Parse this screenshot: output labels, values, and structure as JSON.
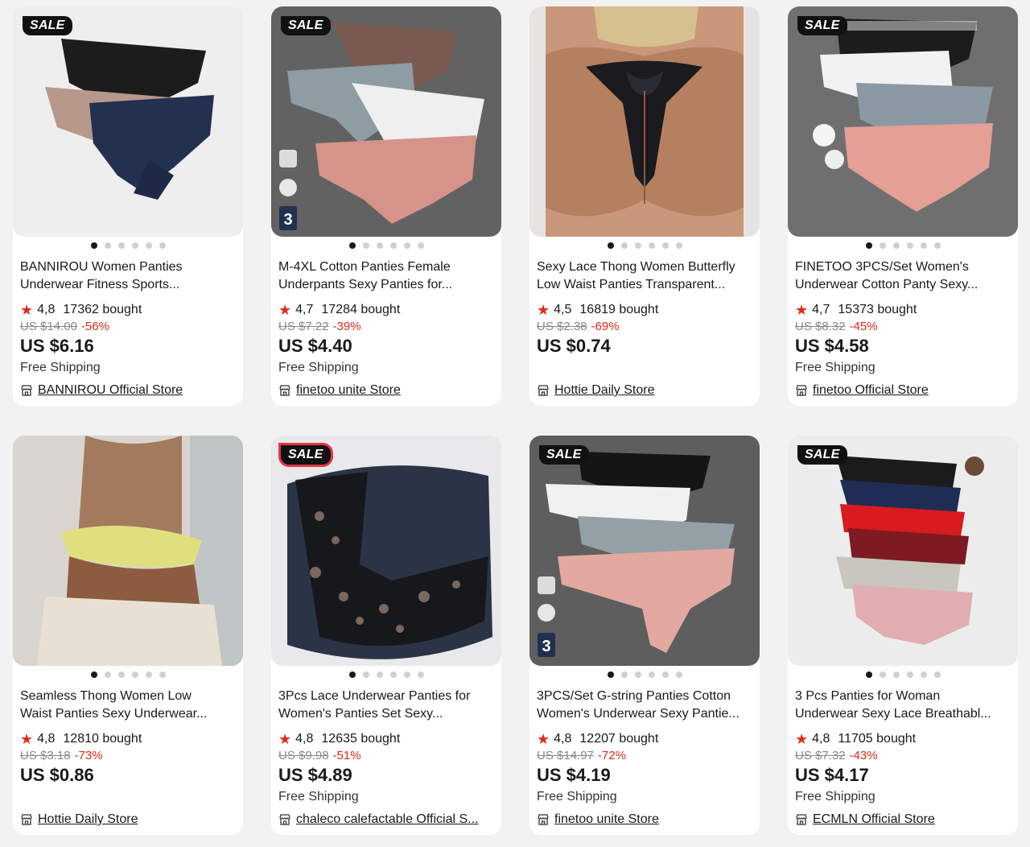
{
  "products": [
    {
      "sale": "SALE",
      "title1": "BANNIROU Women Panties",
      "title2": "Underwear Fitness Sports...",
      "rating": "4,8",
      "bought": "17362 bought",
      "orig_price": "US $14.00",
      "discount": "-56%",
      "price": "US $6.16",
      "shipping": "Free Shipping",
      "store": "BANNIROU Official Store"
    },
    {
      "sale": "SALE",
      "title1": "M-4XL Cotton Panties Female",
      "title2": "Underpants Sexy Panties for...",
      "rating": "4,7",
      "bought": "17284 bought",
      "orig_price": "US $7.22",
      "discount": "-39%",
      "price": "US $4.40",
      "shipping": "Free Shipping",
      "store": "finetoo unite Store"
    },
    {
      "sale": "",
      "title1": "Sexy Lace Thong Women Butterfly",
      "title2": "Low Waist Panties Transparent...",
      "rating": "4,5",
      "bought": "16819 bought",
      "orig_price": "US $2.38",
      "discount": "-69%",
      "price": "US $0.74",
      "shipping": "",
      "store": "Hottie Daily Store"
    },
    {
      "sale": "SALE",
      "title1": "FINETOO 3PCS/Set Women's",
      "title2": "Underwear Cotton Panty Sexy...",
      "rating": "4,7",
      "bought": "15373 bought",
      "orig_price": "US $8.32",
      "discount": "-45%",
      "price": "US $4.58",
      "shipping": "Free Shipping",
      "store": "finetoo Official Store"
    },
    {
      "sale": "",
      "title1": "Seamless Thong Women Low",
      "title2": "Waist Panties Sexy Underwear...",
      "rating": "4,8",
      "bought": "12810 bought",
      "orig_price": "US $3.18",
      "discount": "-73%",
      "price": "US $0.86",
      "shipping": "",
      "store": "Hottie Daily Store"
    },
    {
      "sale": "SALE",
      "title1": "3Pcs Lace Underwear Panties for",
      "title2": "Women's Panties Set Sexy...",
      "rating": "4,8",
      "bought": "12635 bought",
      "orig_price": "US $9.98",
      "discount": "-51%",
      "price": "US $4.89",
      "shipping": "Free Shipping",
      "store": "chaleco calefactable Official S..."
    },
    {
      "sale": "SALE",
      "title1": "3PCS/Set G-string Panties Cotton",
      "title2": "Women's Underwear Sexy Pantie...",
      "rating": "4,8",
      "bought": "12207 bought",
      "orig_price": "US $14.97",
      "discount": "-72%",
      "price": "US $4.19",
      "shipping": "Free Shipping",
      "store": "finetoo unite Store"
    },
    {
      "sale": "SALE",
      "title1": "3 Pcs Panties for Woman",
      "title2": "Underwear Sexy Lace Breathabl...",
      "rating": "4,8",
      "bought": "11705 bought",
      "orig_price": "US $7.32",
      "discount": "-43%",
      "price": "US $4.17",
      "shipping": "Free Shipping",
      "store": "ECMLN Official Store"
    }
  ],
  "colors": {
    "accent_red": "#e02a1a",
    "text": "#191919",
    "muted": "#888888",
    "page_bg": "#f2f2f2"
  },
  "icons": {
    "rating": "star-icon",
    "store": "store-icon"
  }
}
